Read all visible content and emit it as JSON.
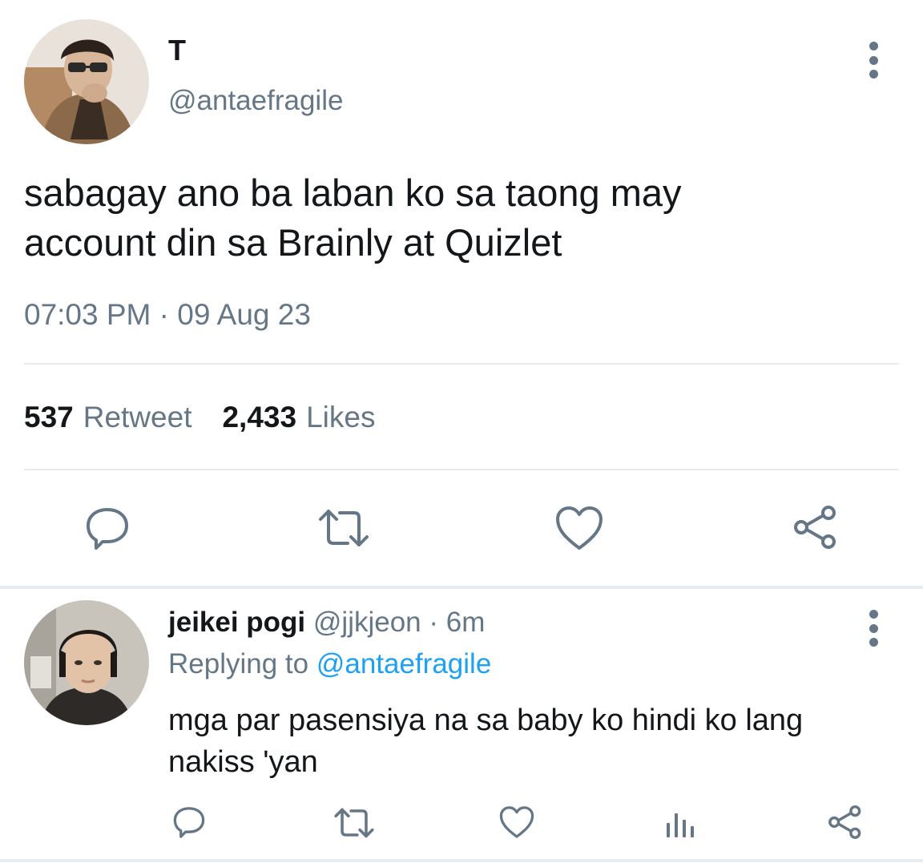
{
  "tweet": {
    "display_name": "T",
    "handle": "@antaefragile",
    "text_line1": "sabagay ano ba laban ko sa taong may",
    "text_line2": "account din sa Brainly at Quizlet",
    "timestamp": "07:03 PM · 09 Aug 23",
    "retweet_count": "537",
    "retweet_label": "Retweet",
    "likes_count": "2,433",
    "likes_label": "Likes",
    "icons": [
      "reply-icon",
      "retweet-icon",
      "like-icon",
      "share-icon"
    ]
  },
  "reply": {
    "display_name": "jeikei pogi",
    "handle": "@jjkjeon",
    "time": "· 6m",
    "replying_prefix": "Replying to",
    "replying_handle": "@antaefragile",
    "text_line1": "mga par pasensiya na sa baby ko hindi ko lang",
    "text_line2": "nakiss 'yan",
    "icons": [
      "reply-icon",
      "retweet-icon",
      "like-icon",
      "analytics-icon",
      "share-icon"
    ]
  },
  "colors": {
    "text": "#14171a",
    "secondary": "#657786",
    "link": "#1da1f2",
    "divider": "#e6ecf0"
  }
}
